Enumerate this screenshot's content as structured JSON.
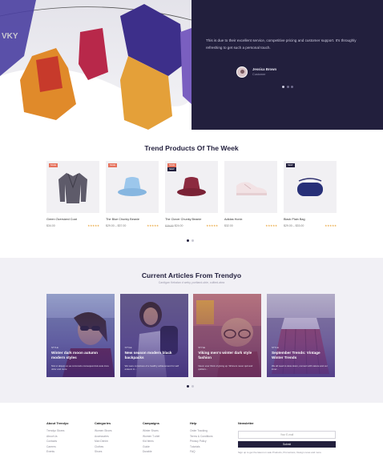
{
  "hero": {
    "quote": "This is due to their excellent service, competitive pricing and customer support. It's throughly refreshing to get such a personal touch.",
    "author_name": "Jessica Brown",
    "author_role": "Customer",
    "colors": {
      "panel": "#221f3d"
    }
  },
  "trend": {
    "title": "Trend Products Of The Week",
    "products": [
      {
        "name": "Green Oversized Coat",
        "price": "$34.00",
        "old_price": "",
        "stars": "★★★★★",
        "badge": "SALE",
        "badge2": ""
      },
      {
        "name": "The Blue Chunky Beanie",
        "price": "$29.00 – $37.00",
        "old_price": "",
        "stars": "★★★★★",
        "badge": "SALE",
        "badge2": ""
      },
      {
        "name": "The Clover Chunky Beanie",
        "price": "$24.00",
        "old_price": "$29.00",
        "stars": "★★★★★",
        "badge": "SALE",
        "badge2": "NEW"
      },
      {
        "name": "Adidas Honix",
        "price": "$32.00",
        "old_price": "",
        "stars": "★★★★★",
        "badge": "",
        "badge2": ""
      },
      {
        "name": "Black Plain Bag",
        "price": "$29.00 – $33.00",
        "old_price": "",
        "stars": "★★★★★",
        "badge": "NEW",
        "badge2": ""
      }
    ]
  },
  "articles": {
    "title": "Current Articles From Trendyo",
    "subtitle": "Cardigan Kebalan d weby, portland-ubie, cultted-atea",
    "items": [
      {
        "category": "STYLE",
        "title": "Winter dark moon autumn modern styles",
        "excerpt": "Nisi ut aliquip ex ea commodo consequat duis aute irure dolor and more"
      },
      {
        "category": "STYLE",
        "title": "New season modern black backpacks",
        "excerpt": "We were conscious of a healthy achievement for self esteem in..."
      },
      {
        "category": "STYLE",
        "title": "Viking men's winter dark style fashion",
        "excerpt": "Never ever think of giving up. Winners never quit and quitters..."
      },
      {
        "category": "STYLE",
        "title": "September Trends: Vintage Winter Trends",
        "excerpt": "We all need to slow down, connect with nature and our inner..."
      }
    ]
  },
  "footer": {
    "columns": [
      {
        "title": "About Trendyo",
        "links": [
          "Trendyo Stores",
          "About Us",
          "Contacts",
          "Careers",
          "Events"
        ]
      },
      {
        "title": "Categories",
        "links": [
          "Women Shoes",
          "Accessories",
          "Man Denim",
          "Clothes",
          "Shoes"
        ]
      },
      {
        "title": "Campaigns",
        "links": [
          "Winter Shoes",
          "Women T-shirt",
          "Kid Items",
          "Guide",
          "Durable"
        ]
      },
      {
        "title": "Help",
        "links": [
          "Order Tracking",
          "Terms & Conditions",
          "Privacy Policy",
          "Tutorials",
          "FAQ"
        ]
      }
    ],
    "newsletter": {
      "title": "Newsletter",
      "placeholder": "Your E-mail",
      "button": "Submit",
      "note": "Sign up to get the latest on sale Products, Promotions, Design news and more"
    }
  }
}
